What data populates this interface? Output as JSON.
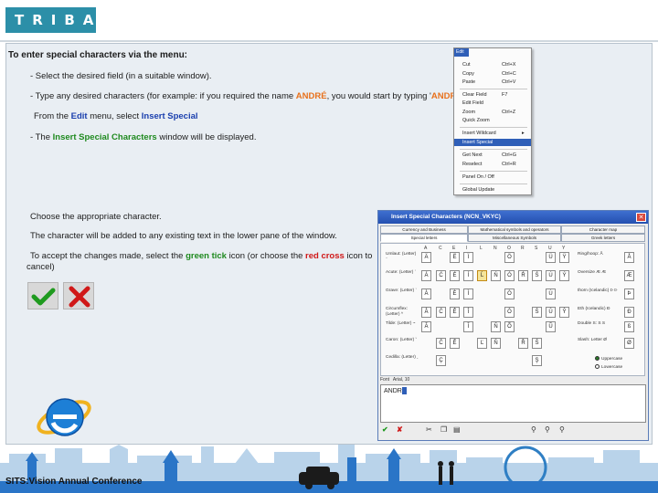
{
  "header": {
    "logo_text": "TRIBAL"
  },
  "instructions": {
    "intro": "To enter special characters via the menu:",
    "step1": "- Select the desired field (in a suitable window).",
    "step2_pre": "- Type any desired characters (for example: if you required the name ",
    "step2_name": "ANDRÉ",
    "step2_mid": ", you would start by typing '",
    "step2_typed": "ANDR",
    "step2_post": "').",
    "step3_pre": "From the ",
    "step3_menu": "Edit",
    "step3_mid": " menu, select ",
    "step3_item": "Insert Special",
    "step4_pre": "- The ",
    "step4_win": "Insert Special Characters",
    "step4_post": " window will be displayed.",
    "choose": "Choose the appropriate character.",
    "added": "The character will be added to any existing text in the lower pane of the window.",
    "accept_pre": "To accept the changes made, select the ",
    "accept_tick": "green tick",
    "accept_mid": " icon (or choose the ",
    "accept_cross": "red cross",
    "accept_post": " icon to",
    "accept_line2": "cancel)"
  },
  "edit_menu": {
    "title": "Edit",
    "items": [
      {
        "label": "Cut",
        "shortcut": "Ctrl+X"
      },
      {
        "label": "Copy",
        "shortcut": "Ctrl+C"
      },
      {
        "label": "Paste",
        "shortcut": "Ctrl+V"
      },
      {
        "label": "Clear Field",
        "shortcut": "F7"
      },
      {
        "label": "Edit Field",
        "shortcut": ""
      },
      {
        "label": "Zoom",
        "shortcut": "Ctrl+Z"
      },
      {
        "label": "Quick Zoom",
        "shortcut": ""
      },
      {
        "label": "Insert Wildcard",
        "shortcut": "▸"
      },
      {
        "label": "Insert Special",
        "shortcut": ""
      },
      {
        "label": "Get Next",
        "shortcut": "Ctrl+G"
      },
      {
        "label": "Reselect",
        "shortcut": "Ctrl+R"
      },
      {
        "label": "Panel On / Off",
        "shortcut": ""
      },
      {
        "label": "Global Update",
        "shortcut": ""
      }
    ]
  },
  "dialog": {
    "title": "Insert Special Characters (NCN_VKYC)",
    "close": "✕",
    "tabs_row1": [
      "Currency and Business",
      "Mathematical symbols and operators",
      "Character map"
    ],
    "tabs_row2": [
      "Special letters",
      "Miscellaneous Symbols",
      "Greek letters"
    ],
    "col_headers": [
      "A",
      "C",
      "E",
      "I",
      "L",
      "N",
      "O",
      "R",
      "S",
      "U",
      "Y"
    ],
    "rows": [
      {
        "label": "Umlaut: (Letter) ¨",
        "chars": [
          "Ä",
          "",
          "Ë",
          "Ï",
          "",
          "",
          "Ö",
          "",
          "",
          "Ü",
          "Ÿ"
        ]
      },
      {
        "label": "Acute: (Letter) ´",
        "chars": [
          "Á",
          "Ć",
          "É",
          "Í",
          "Ĺ",
          "Ń",
          "Ó",
          "Ŕ",
          "Ś",
          "Ú",
          "Ý"
        ]
      },
      {
        "label": "Grave: (Letter) `",
        "chars": [
          "À",
          "",
          "È",
          "Ì",
          "",
          "",
          "Ò",
          "",
          "",
          "Ù",
          ""
        ]
      },
      {
        "label": "Circumflex: (Letter) ^",
        "chars": [
          "Â",
          "Ĉ",
          "Ê",
          "Î",
          "",
          "",
          "Ô",
          "",
          "Ŝ",
          "Û",
          "Ŷ"
        ]
      },
      {
        "label": "Tilde: (Letter) ~",
        "chars": [
          "Ã",
          "",
          "",
          "Ĩ",
          "",
          "Ñ",
          "Õ",
          "",
          "",
          "Ũ",
          ""
        ]
      },
      {
        "label": "Caron: (Letter) ˇ",
        "chars": [
          "",
          "Č",
          "Ě",
          "",
          "Ľ",
          "Ň",
          "",
          "Ř",
          "Š",
          "",
          ""
        ]
      },
      {
        "label": "Cedilla: (Letter) ¸",
        "chars": [
          "",
          "Ç",
          "",
          "",
          "",
          "",
          "",
          "",
          "Ş",
          "",
          ""
        ]
      }
    ],
    "right_items": [
      {
        "label": "Ring/hoop: Å",
        "char": "Å"
      },
      {
        "label": "Oversize Æ Æ",
        "char": "Æ"
      },
      {
        "label": "thorn (Icelandic) Þ Þ",
        "char": "Þ"
      },
      {
        "label": "Eth (Icelandic) Ð",
        "char": "Ð"
      },
      {
        "label": "Double S: S S",
        "char": "ß"
      },
      {
        "label": "Slash: Letter Ø",
        "char": "Ø"
      }
    ],
    "case_options": [
      "Uppercase",
      "Lowercase"
    ],
    "font_label": "Font",
    "font_value": "Arial, 10",
    "text_value": "ANDR"
  },
  "footer": {
    "conference": "SITS:Vision Annual Conference"
  }
}
